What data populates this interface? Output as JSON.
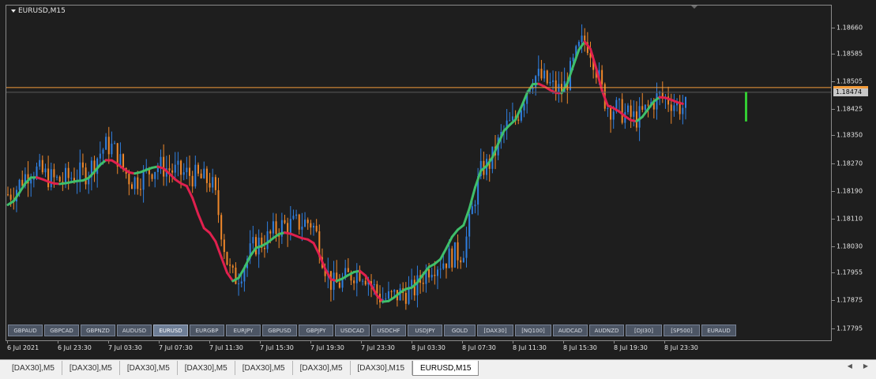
{
  "chart": {
    "title": "EURUSD,M15",
    "symbol": "EURUSD",
    "timeframe": "M15",
    "current_price": "1.18474",
    "price_labels": [
      "1.18660",
      "1.18585",
      "1.18505",
      "1.18425",
      "1.18350",
      "1.18270",
      "1.18190",
      "1.18110",
      "1.18030",
      "1.17955",
      "1.17875",
      "1.17795"
    ],
    "indicator_scale": [
      "100",
      "20"
    ],
    "time_labels": [
      "6 Jul 2021",
      "6 Jul 23:30",
      "7 Jul 03:30",
      "7 Jul 07:30",
      "7 Jul 11:30",
      "7 Jul 15:30",
      "7 Jul 19:30",
      "7 Jul 23:30",
      "8 Jul 03:30",
      "8 Jul 07:30",
      "8 Jul 11:30",
      "8 Jul 15:30",
      "8 Jul 19:30",
      "8 Jul 23:30"
    ],
    "colors": {
      "background": "#1e1e1e",
      "bull_candle": "#2f7fe0",
      "bear_candle": "#f0882a",
      "ma_up": "#3fbf6a",
      "ma_down": "#e0204e",
      "price_line": "#f39c3b",
      "volume_bar": "#33cc33"
    }
  },
  "symbol_buttons": [
    {
      "label": "GBPAUD",
      "active": false
    },
    {
      "label": "GBPCAD",
      "active": false
    },
    {
      "label": "GBPNZD",
      "active": false
    },
    {
      "label": "AUDUSD",
      "active": false
    },
    {
      "label": "EURUSD",
      "active": true
    },
    {
      "label": "EURGBP",
      "active": false
    },
    {
      "label": "EURJPY",
      "active": false
    },
    {
      "label": "GBPUSD",
      "active": false
    },
    {
      "label": "GBPJPY",
      "active": false
    },
    {
      "label": "USDCAD",
      "active": false
    },
    {
      "label": "USDCHF",
      "active": false
    },
    {
      "label": "USDJPY",
      "active": false
    },
    {
      "label": "GOLD",
      "active": false
    },
    {
      "label": "[DAX30]",
      "active": false
    },
    {
      "label": "[NQ100]",
      "active": false
    },
    {
      "label": "AUDCAD",
      "active": false
    },
    {
      "label": "AUDNZD",
      "active": false
    },
    {
      "label": "[DJI30]",
      "active": false
    },
    {
      "label": "[SP500]",
      "active": false
    },
    {
      "label": "EURAUD",
      "active": false
    }
  ],
  "tabs": [
    {
      "label": "[DAX30],M5",
      "active": false
    },
    {
      "label": "[DAX30],M5",
      "active": false
    },
    {
      "label": "[DAX30],M5",
      "active": false
    },
    {
      "label": "[DAX30],M5",
      "active": false
    },
    {
      "label": "[DAX30],M5",
      "active": false
    },
    {
      "label": "[DAX30],M5",
      "active": false
    },
    {
      "label": "[DAX30],M15",
      "active": false
    },
    {
      "label": "EURUSD,M15",
      "active": true
    }
  ],
  "tab_scroll": {
    "left_icon": "arrow-left-icon",
    "right_icon": "arrow-right-icon",
    "left": "◀",
    "right": "▶"
  },
  "chart_data": {
    "type": "candlestick",
    "ylim": [
      1.1776,
      1.1871
    ],
    "x": [
      "6 Jul 2021",
      "6 Jul 23:30",
      "7 Jul 03:30",
      "7 Jul 07:30",
      "7 Jul 11:30",
      "7 Jul 15:30",
      "7 Jul 19:30",
      "7 Jul 23:30",
      "8 Jul 03:30",
      "8 Jul 07:30",
      "8 Jul 11:30",
      "8 Jul 15:30",
      "8 Jul 19:30",
      "8 Jul 23:30"
    ],
    "close": [
      1.1818,
      1.1825,
      1.1822,
      1.1824,
      1.1832,
      1.1822,
      1.1826,
      1.1824,
      1.1822,
      1.1794,
      1.1804,
      1.1809,
      1.181,
      1.1792,
      1.1796,
      1.1788,
      1.179,
      1.1798,
      1.1801,
      1.1826,
      1.1838,
      1.1852,
      1.1848,
      1.1862,
      1.1843,
      1.184,
      1.1846,
      1.1843
    ],
    "series": [
      {
        "name": "Moving average",
        "values": [
          1.1815,
          1.1823,
          1.1821,
          1.1822,
          1.1828,
          1.1824,
          1.1826,
          1.1821,
          1.1807,
          1.1793,
          1.1803,
          1.1807,
          1.1805,
          1.1793,
          1.1796,
          1.1787,
          1.1791,
          1.1798,
          1.1808,
          1.1826,
          1.1838,
          1.185,
          1.1847,
          1.1862,
          1.1843,
          1.1839,
          1.1846,
          1.1844
        ]
      }
    ]
  }
}
